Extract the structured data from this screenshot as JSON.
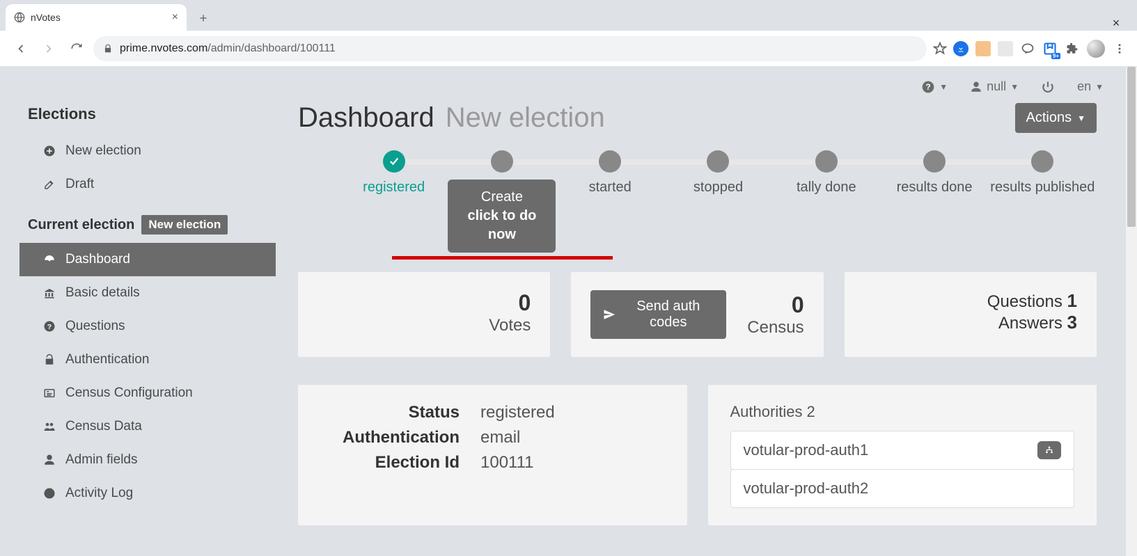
{
  "browser": {
    "tab_title": "nVotes",
    "url_host": "prime.nvotes.com",
    "url_path": "/admin/dashboard/100111"
  },
  "topnav": {
    "user": "null",
    "lang": "en"
  },
  "sidebar": {
    "title": "Elections",
    "new_election": "New election",
    "draft": "Draft",
    "current_group": "Current election",
    "current_badge": "New election",
    "items": [
      {
        "id": "dashboard",
        "label": "Dashboard",
        "active": true
      },
      {
        "id": "basic-details",
        "label": "Basic details"
      },
      {
        "id": "questions",
        "label": "Questions"
      },
      {
        "id": "authentication",
        "label": "Authentication"
      },
      {
        "id": "census-config",
        "label": "Census Configuration"
      },
      {
        "id": "census-data",
        "label": "Census Data"
      },
      {
        "id": "admin-fields",
        "label": "Admin fields"
      },
      {
        "id": "activity-log",
        "label": "Activity Log"
      }
    ]
  },
  "heading": {
    "title": "Dashboard",
    "subtitle": "New election",
    "actions_label": "Actions"
  },
  "steps": {
    "registered": "registered",
    "create": "Create",
    "create_sub": "click to do now",
    "started": "started",
    "stopped": "stopped",
    "tally_done": "tally done",
    "results_done": "results done",
    "results_published": "results published"
  },
  "stats": {
    "votes_value": "0",
    "votes_label": "Votes",
    "census_value": "0",
    "census_label": "Census",
    "send_auth": "Send auth codes",
    "questions_label": "Questions",
    "questions_value": "1",
    "answers_label": "Answers",
    "answers_value": "3"
  },
  "details": {
    "status_k": "Status",
    "status_v": "registered",
    "auth_k": "Authentication",
    "auth_v": "email",
    "eid_k": "Election Id",
    "eid_v": "100111"
  },
  "authorities": {
    "title": "Authorities 2",
    "list": [
      "votular-prod-auth1",
      "votular-prod-auth2"
    ]
  }
}
